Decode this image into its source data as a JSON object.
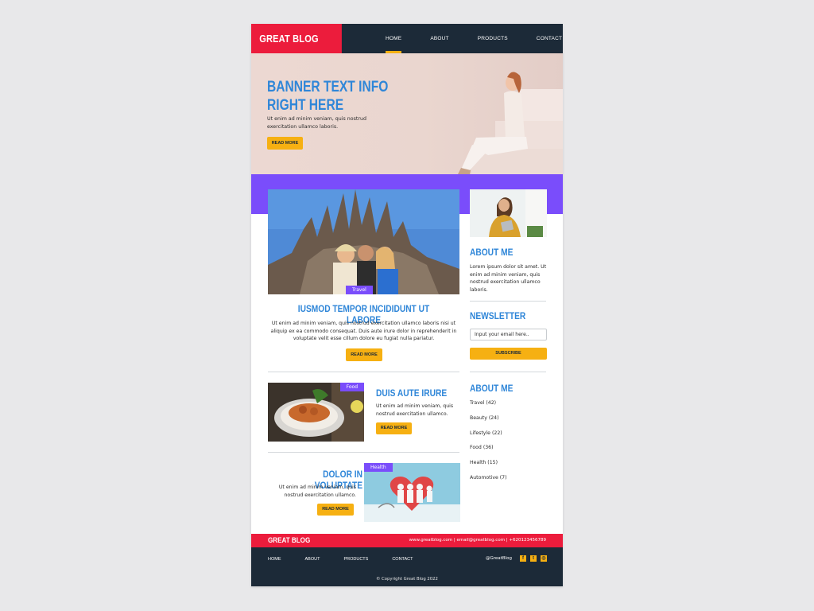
{
  "brand": {
    "name": "GREAT BLOG",
    "accent": "#ec1c3c",
    "navy": "#1c2a38",
    "yellow": "#f6b012",
    "blue": "#2f86d8",
    "purple": "#7a4dfb"
  },
  "nav": [
    {
      "label": "HOME",
      "active": true
    },
    {
      "label": "ABOUT"
    },
    {
      "label": "PRODUCTS"
    },
    {
      "label": "CONTACT"
    }
  ],
  "hero": {
    "title_line1": "BANNER TEXT INFO",
    "title_line2": "RIGHT HERE",
    "text": "Ut enim ad minim veniam, quis nostrud exercitation ullamco laboris.",
    "button": "READ MORE"
  },
  "featured": {
    "tag": "Travel",
    "title": "IUSMOD TEMPOR INCIDIDUNT UT LABORE",
    "text": "Ut enim ad minim veniam, quis nostrud exercitation ullamco laboris nisi ut aliquip ex ea commodo consequat. Duis aute irure dolor in reprehenderit in voluptate velit esse cillum dolore eu fugiat nulla pariatur.",
    "button": "READ MORE"
  },
  "posts": [
    {
      "tag": "Food",
      "title": "DUIS AUTE IRURE",
      "text": "Ut enim ad minim veniam, quis nostrud exercitation ullamco.",
      "button": "READ MORE"
    },
    {
      "tag": "Health",
      "title": "DOLOR IN VOLUPTATE",
      "text": "Ut enim ad minim veniam, quis nostrud exercitation ullamco.",
      "button": "READ MORE"
    }
  ],
  "sidebar": {
    "about_title": "ABOUT ME",
    "about_text": "Lorem ipsum dolor sit amet. Ut enim ad minim veniam, quis nostrud exercitation ullamco laboris.",
    "newsletter_title": "NEWSLETTER",
    "email_placeholder": "Input your email here..",
    "subscribe": "SUBSCRIBE",
    "categories_title": "ABOUT ME",
    "categories": [
      {
        "name": "Travel",
        "count": "(42)"
      },
      {
        "name": "Beauty",
        "count": "(24)"
      },
      {
        "name": "Lifestyle",
        "count": "(22)"
      },
      {
        "name": "Food",
        "count": "(36)"
      },
      {
        "name": "Health",
        "count": "(15)"
      },
      {
        "name": "Automotive",
        "count": "(7)"
      }
    ]
  },
  "footer": {
    "logo": "GREAT BLOG",
    "contact": "www.greatblog.com  |  email@greatblog.com  |  +620123456789",
    "nav": [
      "HOME",
      "ABOUT",
      "PRODUCTS",
      "CONTACT"
    ],
    "handle": "@GreatBlog",
    "social_icons": [
      "facebook-icon",
      "twitter-icon",
      "instagram-icon"
    ],
    "copyright": "© Copyright Great Blog 2022"
  }
}
